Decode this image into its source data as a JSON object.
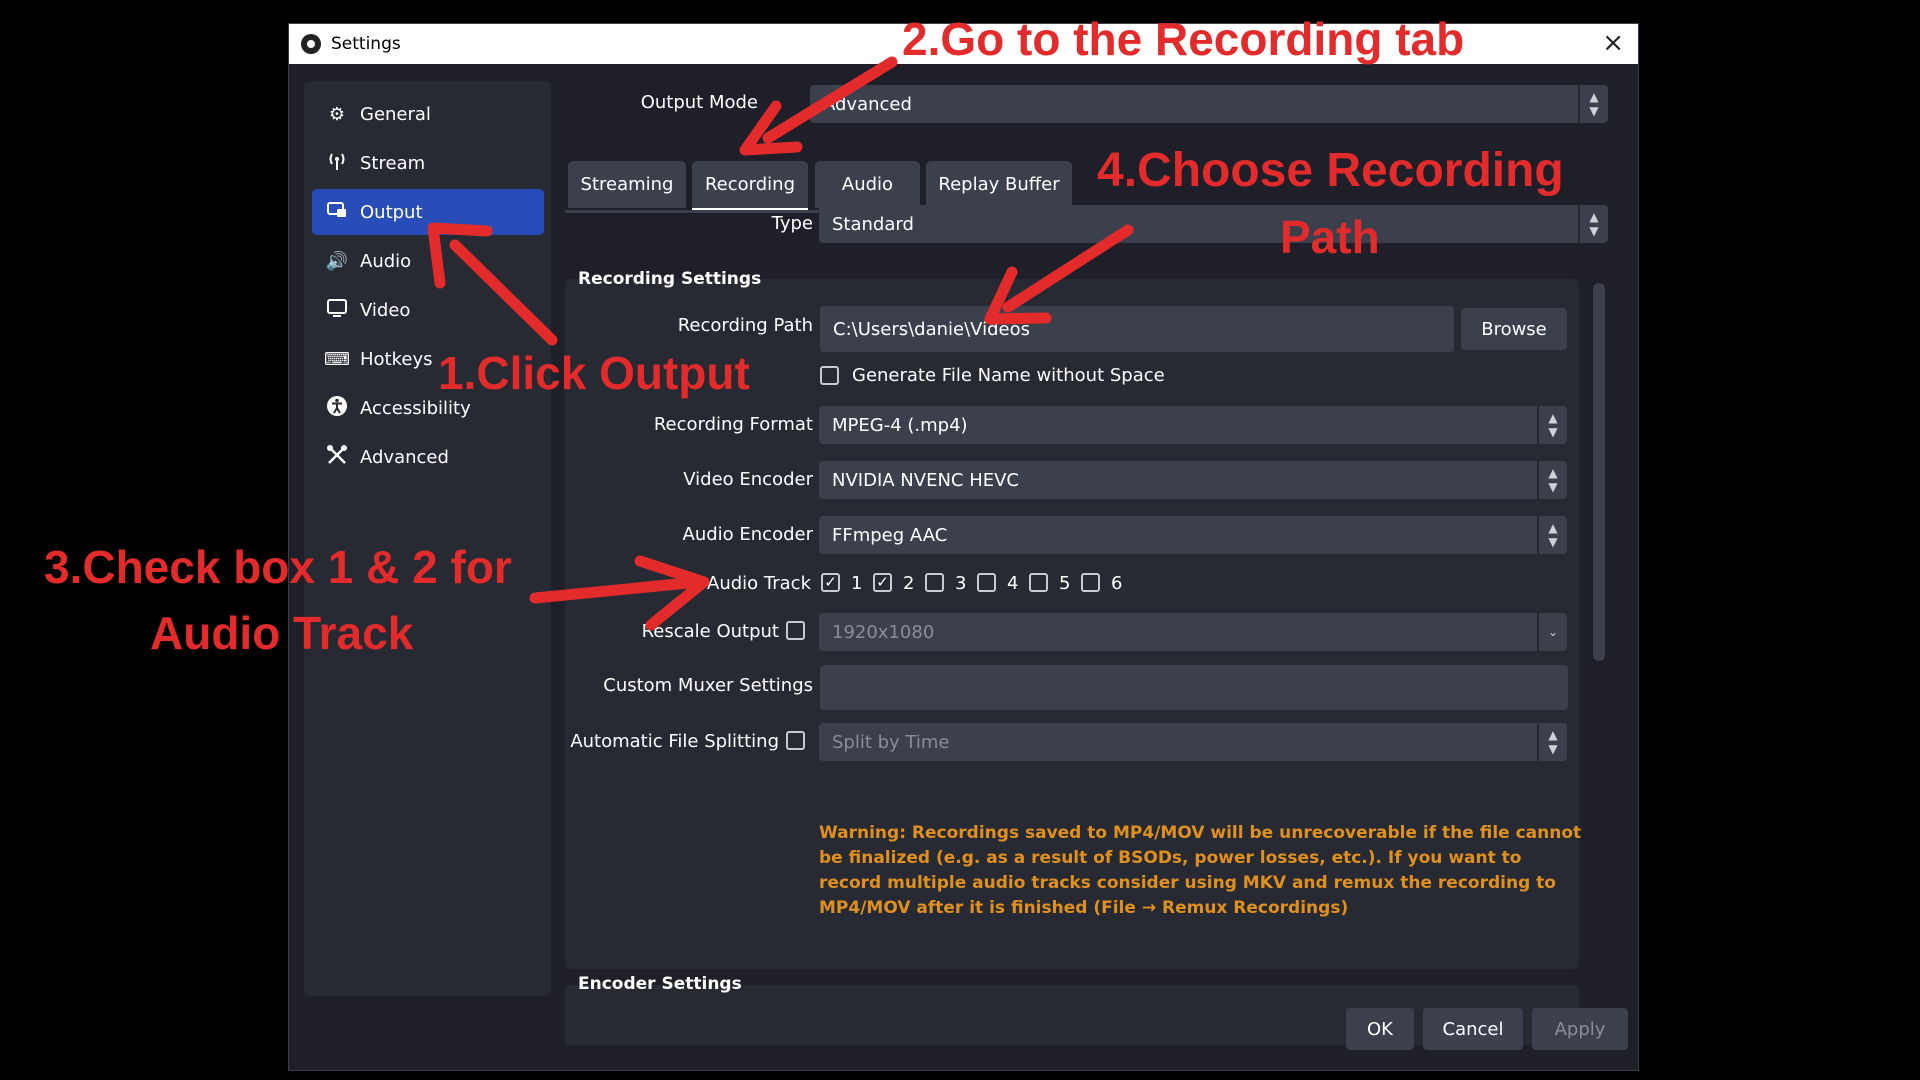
{
  "window": {
    "title": "Settings",
    "close_glyph": "×"
  },
  "sidebar": {
    "items": [
      {
        "label": "General",
        "icon": "gear-icon"
      },
      {
        "label": "Stream",
        "icon": "antenna-icon"
      },
      {
        "label": "Output",
        "icon": "output-icon"
      },
      {
        "label": "Audio",
        "icon": "speaker-icon"
      },
      {
        "label": "Video",
        "icon": "monitor-icon"
      },
      {
        "label": "Hotkeys",
        "icon": "keyboard-icon"
      },
      {
        "label": "Accessibility",
        "icon": "accessibility-icon"
      },
      {
        "label": "Advanced",
        "icon": "tools-icon"
      }
    ],
    "active_index": 2
  },
  "output_mode": {
    "label": "Output Mode",
    "value": "Advanced"
  },
  "tabs": [
    {
      "label": "Streaming"
    },
    {
      "label": "Recording"
    },
    {
      "label": "Audio"
    },
    {
      "label": "Replay Buffer"
    }
  ],
  "active_tab": "Recording",
  "type": {
    "label": "Type",
    "value": "Standard"
  },
  "recording_settings": {
    "title": "Recording Settings",
    "recording_path": {
      "label": "Recording Path",
      "value": "C:\\Users\\danie\\Videos",
      "browse_label": "Browse"
    },
    "generate_filename": {
      "label": "Generate File Name without Space",
      "checked": false
    },
    "recording_format": {
      "label": "Recording Format",
      "value": "MPEG-4 (.mp4)"
    },
    "video_encoder": {
      "label": "Video Encoder",
      "value": "NVIDIA NVENC HEVC"
    },
    "audio_encoder": {
      "label": "Audio Encoder",
      "value": "FFmpeg AAC"
    },
    "audio_track": {
      "label": "Audio Track",
      "tracks": [
        {
          "number": "1",
          "checked": true
        },
        {
          "number": "2",
          "checked": true
        },
        {
          "number": "3",
          "checked": false
        },
        {
          "number": "4",
          "checked": false
        },
        {
          "number": "5",
          "checked": false
        },
        {
          "number": "6",
          "checked": false
        }
      ]
    },
    "rescale_output": {
      "label": "Rescale Output",
      "checked": false,
      "value": "1920x1080"
    },
    "custom_muxer": {
      "label": "Custom Muxer Settings",
      "value": ""
    },
    "auto_split": {
      "label": "Automatic File Splitting",
      "checked": false,
      "value": "Split by Time"
    },
    "warning": "Warning: Recordings saved to MP4/MOV will be unrecoverable if the file cannot be finalized (e.g. as a result of BSODs, power losses, etc.). If you want to record multiple audio tracks consider using MKV and remux the recording to MP4/MOV after it is finished (File → Remux Recordings)"
  },
  "encoder_settings": {
    "title": "Encoder Settings"
  },
  "buttons": {
    "ok": "OK",
    "cancel": "Cancel",
    "apply": "Apply"
  },
  "annotations": {
    "step1": "1.Click Output",
    "step2": "2.Go to the Recording tab",
    "step3_line1": "3.Check box 1 & 2 for",
    "step3_line2": "Audio Track",
    "step4_line1": "4.Choose Recording",
    "step4_line2": "Path"
  },
  "colors": {
    "accent": "#284cb8",
    "warning": "#e0901f",
    "annotation": "#e32b2b",
    "panel": "#272a33",
    "field": "#3c404d"
  }
}
